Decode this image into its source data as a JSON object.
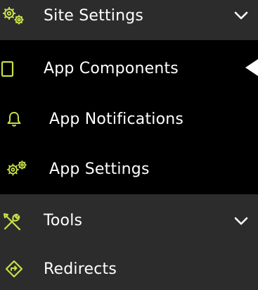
{
  "colors": {
    "group_bg": "#2c2c2c",
    "sub_bg": "#000000",
    "accent": "#c6e048",
    "text": "#ffffff"
  },
  "menu": {
    "site_settings": {
      "label": "Site Settings",
      "icon": "gears-icon",
      "chevron": "chevron-down-icon"
    },
    "items": [
      {
        "label": "App Components",
        "icon": "page-icon",
        "active": true
      },
      {
        "label": "App Notifications",
        "icon": "bell-icon"
      },
      {
        "label": "App Settings",
        "icon": "gears-icon"
      }
    ],
    "tools": {
      "label": "Tools",
      "icon": "tools-icon",
      "chevron": "chevron-down-icon"
    },
    "redirects": {
      "label": "Redirects",
      "icon": "redirect-icon"
    }
  }
}
